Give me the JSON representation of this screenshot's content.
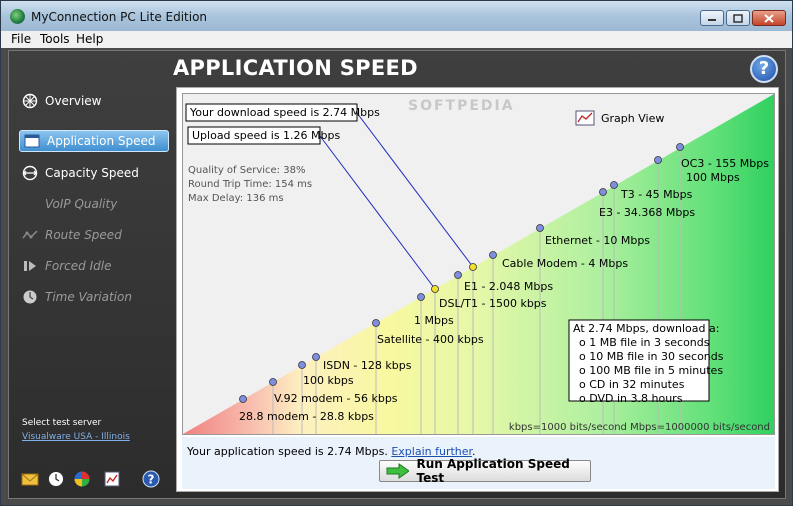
{
  "window": {
    "title": "MyConnection PC Lite Edition"
  },
  "menu": {
    "file": "File",
    "tools": "Tools",
    "help": "Help"
  },
  "nav": {
    "overview": "Overview",
    "application_speed": "Application Speed",
    "capacity_speed": "Capacity Speed",
    "voip_quality": "VoIP Quality",
    "route_speed": "Route Speed",
    "forced_idle": "Forced Idle",
    "time_variation": "Time Variation"
  },
  "server": {
    "label": "Select test server",
    "value": "Visualware USA - Illinois"
  },
  "page": {
    "title": "APPLICATION SPEED",
    "help": "?"
  },
  "chart": {
    "download_box": "Your download speed is 2.74 Mbps",
    "upload_box": "Upload speed is 1.26 Mbps",
    "qos": "Quality of Service: 38%",
    "rtt": "Round Trip Time: 154 ms",
    "delay": "Max Delay: 136 ms",
    "graph_view": "Graph View",
    "units_note": "kbps=1000 bits/second   Mbps=1000000 bits/second",
    "levels": {
      "oc3": "OC3 - 155 Mbps",
      "m100": "100 Mbps",
      "t3": "T3 - 45 Mbps",
      "e3": "E3 - 34.368 Mbps",
      "ethernet": "Ethernet - 10 Mbps",
      "cable": "Cable Modem - 4 Mbps",
      "e1": "E1 - 2.048 Mbps",
      "dsl": "DSL/T1 - 1500 kbps",
      "m1": "1 Mbps",
      "satellite": "Satellite - 400 kbps",
      "isdn": "ISDN - 128 kbps",
      "k100": "100 kbps",
      "v92": "V.92 modem - 56 kbps",
      "m288": "28.8 modem - 28.8 kbps"
    },
    "download_info": {
      "title": "At 2.74 Mbps, download a:",
      "l1": "o 1 MB file in 3 seconds",
      "l2": "o 10 MB file in 30 seconds",
      "l3": "o 100 MB file in 5 minutes",
      "l4": "o CD in 32 minutes",
      "l5": "o DVD in 3.8 hours"
    }
  },
  "status": {
    "text": "Your application speed is 2.74 Mbps.",
    "link": "Explain further",
    "suffix": ".",
    "run_button": "Run Application Speed Test"
  },
  "colors": {
    "accent_blue": "#3f8fd0",
    "dot_blue": "#7f8fe0",
    "dot_yellow": "#f0e030",
    "run_arrow": "#3fbf3f"
  },
  "watermark": "SOFTPEDIA"
}
